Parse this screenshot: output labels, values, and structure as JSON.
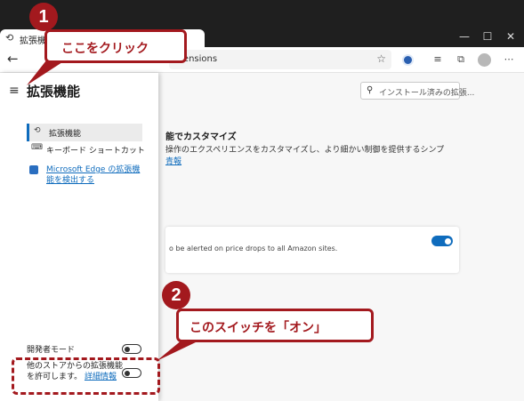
{
  "browser": {
    "tab_title": "拡張機能",
    "address_text": "tensions",
    "window_minimize": "—",
    "window_maximize": "☐",
    "window_close": "✕"
  },
  "sidebar": {
    "title": "拡張機能",
    "nav_items": [
      {
        "label": "拡張機能",
        "icon": "puzzle-icon",
        "active": true
      },
      {
        "label": "キーボード ショートカット",
        "icon": "keyboard-icon",
        "active": false
      }
    ],
    "store_link": "Microsoft Edge の拡張機能を検出する",
    "developer_mode_label": "開発者モード",
    "allow_other_stores_text": "他のストアからの拡張機能を許可します。",
    "allow_other_stores_link": "詳細情報"
  },
  "main": {
    "search_placeholder": "インストール済みの拡張...",
    "section_title": "能でカスタマイズ",
    "section_desc": "操作のエクスペリエンスをカスタマイズし、より細かい制御を提供するシンプ",
    "section_link": "青報",
    "extension_desc": "o be alerted on price drops to all Amazon sites."
  },
  "callouts": {
    "one_number": "1",
    "one_text": "ここをクリック",
    "two_number": "2",
    "two_text": "このスイッチを「オン」"
  },
  "colors": {
    "accent": "#0f6cbd",
    "callout": "#a3191e",
    "titlebar": "#1f1f1f"
  }
}
